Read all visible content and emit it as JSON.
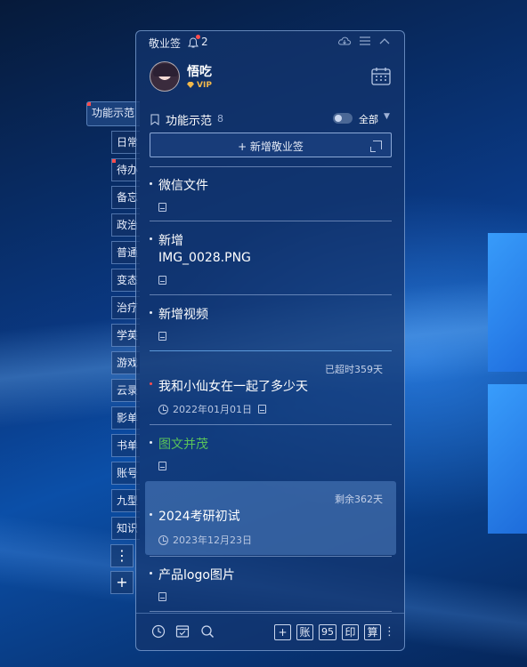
{
  "app": {
    "title": "敬业签",
    "notification_count": "2"
  },
  "user": {
    "name": "悟吃",
    "badge": "VIP"
  },
  "list_header": {
    "title": "功能示范",
    "count": "8",
    "filter": "全部"
  },
  "add_note_label": "+ 新增敬业签",
  "side_tabs": [
    "功能示范",
    "日常",
    "待办",
    "备忘",
    "政治",
    "普通",
    "变态",
    "治疗",
    "学英",
    "游戏",
    "云录",
    "影单",
    "书单",
    "账号",
    "九型",
    "知识"
  ],
  "side_buttons": {
    "more": "⋮",
    "add": "+"
  },
  "notes": [
    {
      "title": "微信文件",
      "date": "",
      "status": ""
    },
    {
      "title": "新增\nIMG_0028.PNG",
      "date": "",
      "status": ""
    },
    {
      "title": "新增视频",
      "date": "",
      "status": ""
    },
    {
      "title": "我和小仙女在一起了多少天",
      "date": "2022年01月01日",
      "status": "已超时359天"
    },
    {
      "title": "图文并茂",
      "date": "",
      "status": ""
    },
    {
      "title": "2024考研初试",
      "date": "2023年12月23日",
      "status": "剩余362天"
    },
    {
      "title": "产品logo图片",
      "date": "",
      "status": ""
    }
  ],
  "bottom_toolbar": {
    "add": "+",
    "account": "账",
    "score": "95",
    "print": "印",
    "calc": "算",
    "more": "⋮"
  },
  "colors": {
    "accent_red": "#ff4d4d",
    "green_title": "#59c25a",
    "vip_gold": "#f2b84b"
  }
}
